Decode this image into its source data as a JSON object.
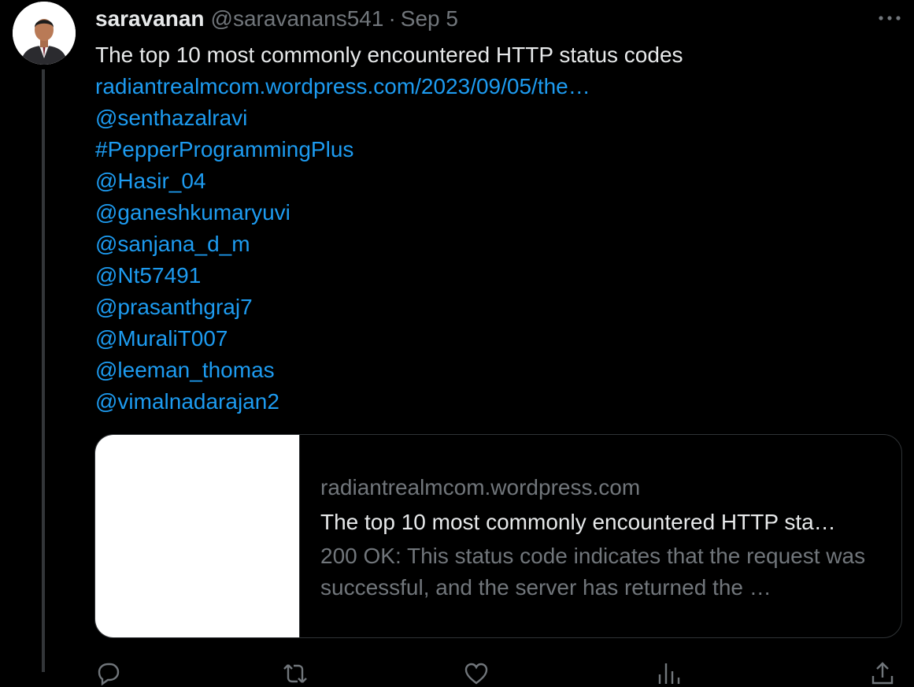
{
  "tweet": {
    "display_name": "saravanan",
    "handle": "@saravanans541",
    "separator": "·",
    "date": "Sep 5",
    "more_icon": "more-horizontal-icon",
    "avatar": "user-avatar-photo",
    "text": "The top 10 most commonly encountered HTTP status codes",
    "url": "radiantrealmcom.wordpress.com/2023/09/05/the…",
    "mentions": [
      "@senthazalravi",
      "#PepperProgrammingPlus",
      "@Hasir_04",
      "@ganeshkumaryuvi",
      "@sanjana_d_m",
      "@Nt57491",
      "@prasanthgraj7",
      "@MuraliT007",
      "@leeman_thomas",
      "@vimalnadarajan2"
    ]
  },
  "card": {
    "domain": "radiantrealmcom.wordpress.com",
    "title": "The top 10 most commonly encountered HTTP sta…",
    "description": "200 OK: This status code indicates that the request was successful, and the server has returned the …"
  },
  "actions": {
    "icons": [
      "reply-icon",
      "retweet-icon",
      "like-icon",
      "views-icon",
      "share-icon"
    ]
  },
  "colors": {
    "background": "#000000",
    "text": "#e7e9ea",
    "muted": "#71767b",
    "link": "#1d9bf0",
    "border": "#2f3336"
  }
}
